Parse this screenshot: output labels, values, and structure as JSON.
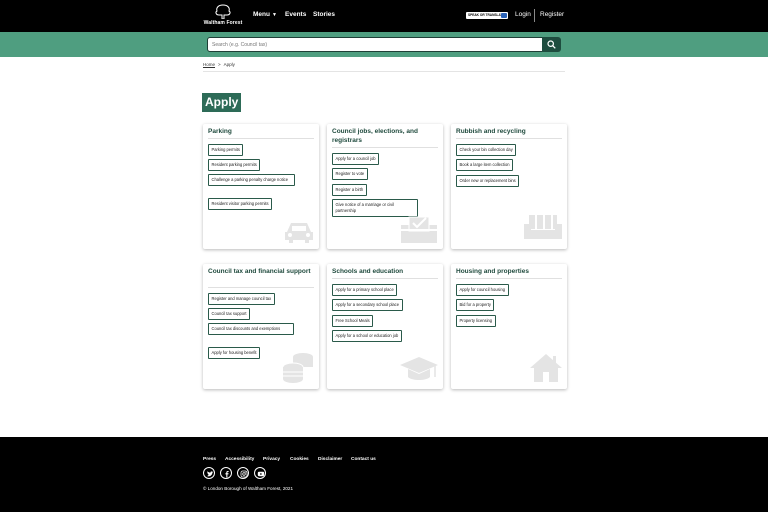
{
  "header": {
    "logo_text": "Waltham Forest",
    "nav": [
      {
        "label": "Menu"
      },
      {
        "label": "Events"
      },
      {
        "label": "Stories"
      }
    ],
    "speak_label": "SPEAK OR TRANSLATE",
    "login_label": "Login",
    "register_label": "Register"
  },
  "search": {
    "placeholder": "Search (e.g. Council tax)"
  },
  "breadcrumb": {
    "home": "Home",
    "current": "Apply"
  },
  "page_title": "Apply",
  "cards": [
    {
      "title": "Parking",
      "links": [
        "Parking permits",
        "Resident parking permits",
        "Challenge a parking penalty charge notice",
        "Resident visitor parking permits"
      ],
      "icon": "car-icon"
    },
    {
      "title": "Council jobs, elections, and registrars",
      "links": [
        "Apply for a council job",
        "Register to vote",
        "Register a birth",
        "Give notice of a marriage or civil partnership"
      ],
      "icon": "ballot-box-icon"
    },
    {
      "title": "Rubbish and recycling",
      "links": [
        "Check your bin collection day",
        "Book a large item collection",
        "Order new or replacement bins"
      ],
      "icon": "sofa-icon"
    },
    {
      "title": "Council tax and financial support",
      "links": [
        "Register and manage council tax",
        "Council tax support",
        "Council tax discounts and exemptions",
        "Apply for housing benefit"
      ],
      "icon": "coins-icon"
    },
    {
      "title": "Schools and education",
      "links": [
        "Apply for a primary school place",
        "Apply for a secondary school place",
        "Free School Meals",
        "Apply for a school or education job"
      ],
      "icon": "graduation-cap-icon"
    },
    {
      "title": "Housing and properties",
      "links": [
        "Apply for council housing",
        "Bid for a property",
        "Property licensing"
      ],
      "icon": "house-icon"
    }
  ],
  "footer": {
    "links": [
      "Press",
      "Accessibility",
      "Privacy",
      "Cookies",
      "Disclaimer",
      "Contact us"
    ],
    "social": [
      "twitter-icon",
      "facebook-icon",
      "instagram-icon",
      "youtube-icon"
    ],
    "copyright": "© London Borough of Waltham Forest, 2021"
  },
  "colors": {
    "brand_green": "#2d6b57",
    "search_band": "#4f9e80",
    "search_button": "#1e4d3f",
    "card_title": "#1f4a3d"
  }
}
